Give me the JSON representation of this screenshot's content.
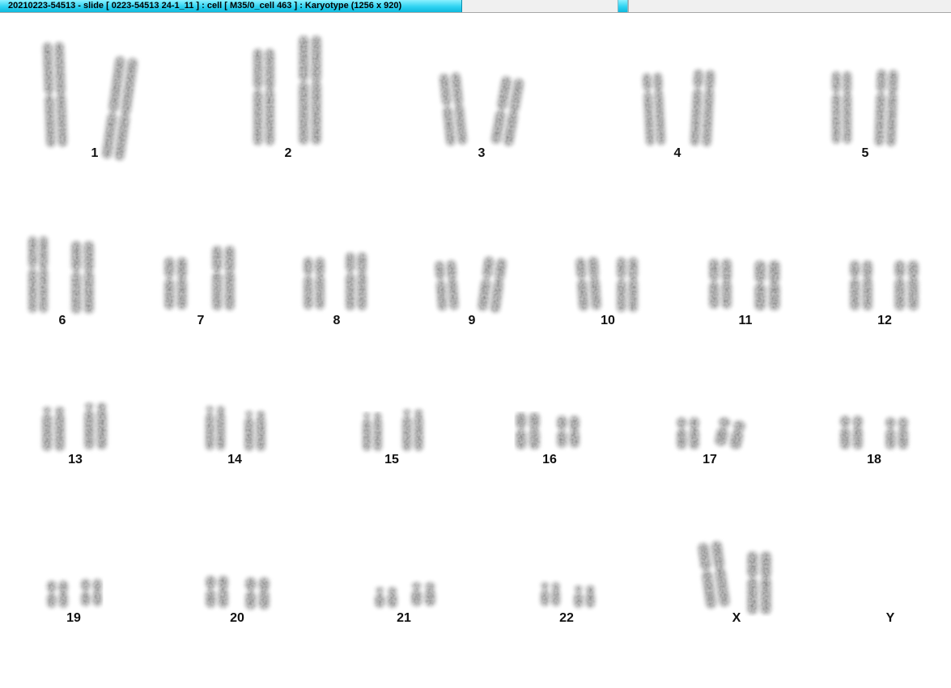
{
  "window": {
    "title": "20210223-54513 - slide [ 0223-54513 24-1_11 ] : cell [ M35/0_cell 463 ] : Karyotype  (1256 x 920)"
  },
  "karyotype": {
    "pairs": [
      {
        "label": "1",
        "count": 2
      },
      {
        "label": "2",
        "count": 2
      },
      {
        "label": "3",
        "count": 2
      },
      {
        "label": "4",
        "count": 2
      },
      {
        "label": "5",
        "count": 2
      },
      {
        "label": "6",
        "count": 2
      },
      {
        "label": "7",
        "count": 2
      },
      {
        "label": "8",
        "count": 2
      },
      {
        "label": "9",
        "count": 2
      },
      {
        "label": "10",
        "count": 2
      },
      {
        "label": "11",
        "count": 2
      },
      {
        "label": "12",
        "count": 2
      },
      {
        "label": "13",
        "count": 2
      },
      {
        "label": "14",
        "count": 2
      },
      {
        "label": "15",
        "count": 2
      },
      {
        "label": "16",
        "count": 2
      },
      {
        "label": "17",
        "count": 2
      },
      {
        "label": "18",
        "count": 2
      },
      {
        "label": "19",
        "count": 2
      },
      {
        "label": "20",
        "count": 2
      },
      {
        "label": "21",
        "count": 2
      },
      {
        "label": "22",
        "count": 2
      },
      {
        "label": "X",
        "count": 2
      },
      {
        "label": "Y",
        "count": 0
      }
    ],
    "colors": {
      "chromatin": "#5a5a5a",
      "chromatin_dark": "#3a3a3a",
      "label": "#111111"
    }
  }
}
